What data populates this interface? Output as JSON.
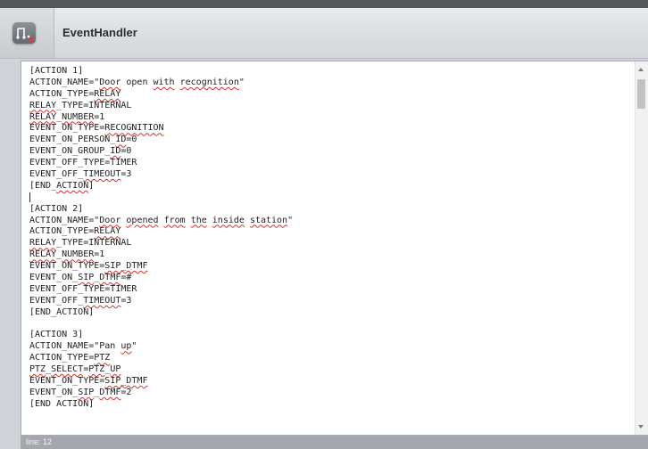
{
  "window": {
    "title": "EventHandler",
    "app_icon": "event-handler-icon",
    "accent_color": "#d0342c"
  },
  "editor": {
    "lines": [
      {
        "segments": [
          {
            "t": "[ACTION 1]"
          }
        ]
      },
      {
        "segments": [
          {
            "t": "ACTION_NAME=\""
          },
          {
            "t": "Door",
            "s": 1
          },
          {
            "t": " open "
          },
          {
            "t": "with",
            "s": 1
          },
          {
            "t": " "
          },
          {
            "t": "recognition",
            "s": 1
          },
          {
            "t": "\""
          }
        ]
      },
      {
        "segments": [
          {
            "t": "ACTION_TYPE="
          },
          {
            "t": "RELAY",
            "s": 1
          }
        ]
      },
      {
        "segments": [
          {
            "t": "RELAY",
            "s": 1
          },
          {
            "t": "_TYPE=INTERNAL"
          }
        ]
      },
      {
        "segments": [
          {
            "t": "RELAY",
            "s": 1
          },
          {
            "t": "_"
          },
          {
            "t": "NUMBER",
            "s": 1
          },
          {
            "t": "=1"
          }
        ]
      },
      {
        "segments": [
          {
            "t": "EVENT_ON_TYPE="
          },
          {
            "t": "RECOGNITION",
            "s": 1
          }
        ]
      },
      {
        "segments": [
          {
            "t": "EVENT_ON_PERSON_"
          },
          {
            "t": "ID",
            "s": 1
          },
          {
            "t": "=0"
          }
        ]
      },
      {
        "segments": [
          {
            "t": "EVENT_ON_GROUP_"
          },
          {
            "t": "ID",
            "s": 1
          },
          {
            "t": "=0"
          }
        ]
      },
      {
        "segments": [
          {
            "t": "EVENT_OFF_TYPE=TIMER"
          }
        ]
      },
      {
        "segments": [
          {
            "t": "EVENT_OFF_"
          },
          {
            "t": "TIMEOUT",
            "s": 1
          },
          {
            "t": "=3"
          }
        ]
      },
      {
        "segments": [
          {
            "t": "[END_"
          },
          {
            "t": "ACTION",
            "s": 1
          },
          {
            "t": "]"
          }
        ]
      },
      {
        "caret": true,
        "segments": []
      },
      {
        "segments": [
          {
            "t": "[ACTION 2]"
          }
        ]
      },
      {
        "segments": [
          {
            "t": "ACTION_NAME=\""
          },
          {
            "t": "Door",
            "s": 1
          },
          {
            "t": " "
          },
          {
            "t": "opened",
            "s": 1
          },
          {
            "t": " "
          },
          {
            "t": "from",
            "s": 1
          },
          {
            "t": " "
          },
          {
            "t": "the",
            "s": 1
          },
          {
            "t": " "
          },
          {
            "t": "inside",
            "s": 1
          },
          {
            "t": " "
          },
          {
            "t": "station",
            "s": 1
          },
          {
            "t": "\""
          }
        ]
      },
      {
        "segments": [
          {
            "t": "ACTION_TYPE="
          },
          {
            "t": "RELAY",
            "s": 1
          }
        ]
      },
      {
        "segments": [
          {
            "t": "RELAY",
            "s": 1
          },
          {
            "t": "_TYPE=INTERNAL"
          }
        ]
      },
      {
        "segments": [
          {
            "t": "RELAY",
            "s": 1
          },
          {
            "t": "_"
          },
          {
            "t": "NUMBER",
            "s": 1
          },
          {
            "t": "=1"
          }
        ]
      },
      {
        "segments": [
          {
            "t": "EVENT_ON_TYPE="
          },
          {
            "t": "SIP_DTMF",
            "s": 1
          }
        ]
      },
      {
        "segments": [
          {
            "t": "EVENT_ON_"
          },
          {
            "t": "SIP",
            "s": 1
          },
          {
            "t": "_"
          },
          {
            "t": "DTMF",
            "s": 1
          },
          {
            "t": "=#"
          }
        ]
      },
      {
        "segments": [
          {
            "t": "EVENT_OFF_TYPE=TIMER"
          }
        ]
      },
      {
        "segments": [
          {
            "t": "EVENT_OFF_"
          },
          {
            "t": "TIMEOUT",
            "s": 1
          },
          {
            "t": "=3"
          }
        ]
      },
      {
        "segments": [
          {
            "t": "[END_ACTION]"
          }
        ]
      },
      {
        "segments": []
      },
      {
        "segments": [
          {
            "t": "[ACTION 3]"
          }
        ]
      },
      {
        "segments": [
          {
            "t": "ACTION_NAME=\"Pan "
          },
          {
            "t": "up",
            "s": 1
          },
          {
            "t": "\""
          }
        ]
      },
      {
        "segments": [
          {
            "t": "ACTION_TYPE="
          },
          {
            "t": "PTZ",
            "s": 1
          }
        ]
      },
      {
        "segments": [
          {
            "t": "PTZ",
            "s": 1
          },
          {
            "t": "_"
          },
          {
            "t": "SELECT",
            "s": 1
          },
          {
            "t": "="
          },
          {
            "t": "PTZ",
            "s": 1
          },
          {
            "t": "_"
          },
          {
            "t": "UP",
            "s": 1
          }
        ]
      },
      {
        "segments": [
          {
            "t": "EVENT_ON_TYPE="
          },
          {
            "t": "SIP_DTMF",
            "s": 1
          }
        ]
      },
      {
        "segments": [
          {
            "t": "EVENT_ON_"
          },
          {
            "t": "SIP",
            "s": 1
          },
          {
            "t": "_"
          },
          {
            "t": "DTMF",
            "s": 1
          },
          {
            "t": "=2"
          }
        ]
      },
      {
        "segments": [
          {
            "t": "[END ACTION]"
          }
        ]
      }
    ]
  },
  "status": {
    "text": "line: 12"
  }
}
